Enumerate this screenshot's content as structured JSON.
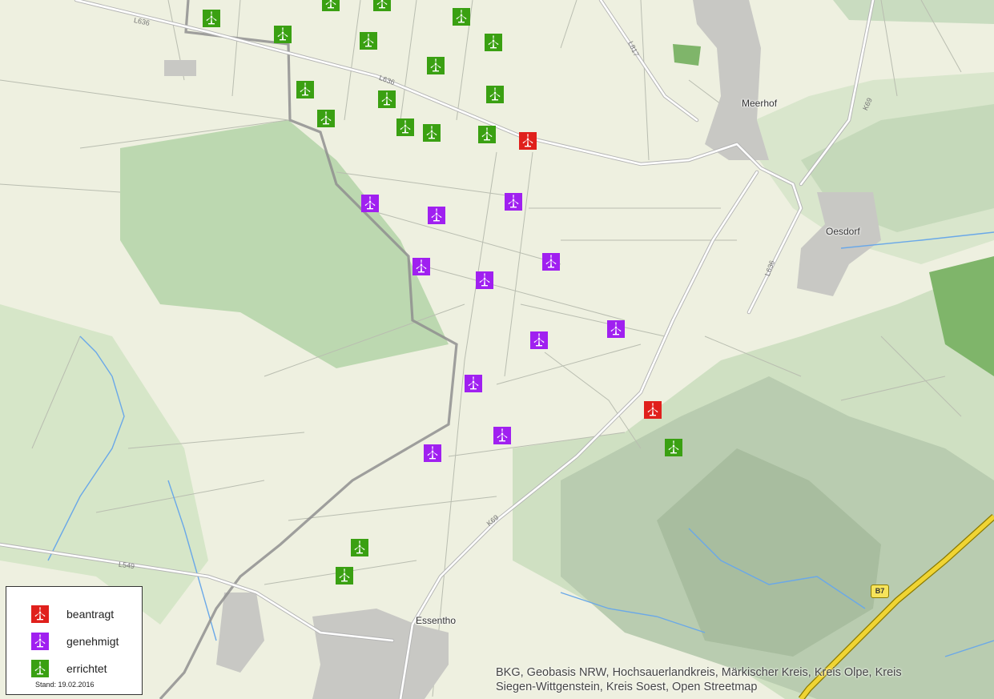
{
  "colors": {
    "beantragt": "#e0201c",
    "genehmigt": "#a020f0",
    "errichtet": "#3aa012"
  },
  "icon": "wind-turbine-icon",
  "places": {
    "meerhof": "Meerhof",
    "oesdorf": "Oesdorf",
    "essentho": "Essentho"
  },
  "roads": {
    "l636_a": "L636",
    "l636_b": "L636",
    "l817": "L817",
    "k69_a": "K69",
    "k69_b": "K69",
    "l636_c": "L636",
    "l549": "L549",
    "b7": "B7"
  },
  "legend": {
    "items": [
      {
        "status": "beantragt",
        "label": "beantragt"
      },
      {
        "status": "genehmigt",
        "label": "genehmigt"
      },
      {
        "status": "errichtet",
        "label": "errichtet"
      }
    ],
    "date": "Stand: 19.02.2016"
  },
  "attribution": {
    "line1": "BKG, Geobasis NRW, Hochsauerlandkreis, Märkischer Kreis, Kreis Olpe, Kreis",
    "line2": "Siegen-Wittgenstein, Kreis Soest, Open Streetmap"
  },
  "turbines": [
    {
      "status": "errichtet"
    },
    {
      "status": "errichtet"
    },
    {
      "status": "errichtet"
    },
    {
      "status": "errichtet"
    },
    {
      "status": "errichtet"
    },
    {
      "status": "errichtet"
    },
    {
      "status": "errichtet"
    },
    {
      "status": "errichtet"
    },
    {
      "status": "errichtet"
    },
    {
      "status": "errichtet"
    },
    {
      "status": "errichtet"
    },
    {
      "status": "errichtet"
    },
    {
      "status": "errichtet"
    },
    {
      "status": "errichtet"
    },
    {
      "status": "errichtet"
    },
    {
      "status": "beantragt"
    },
    {
      "status": "genehmigt"
    },
    {
      "status": "genehmigt"
    },
    {
      "status": "genehmigt"
    },
    {
      "status": "genehmigt"
    },
    {
      "status": "genehmigt"
    },
    {
      "status": "genehmigt"
    },
    {
      "status": "genehmigt"
    },
    {
      "status": "genehmigt"
    },
    {
      "status": "genehmigt"
    },
    {
      "status": "genehmigt"
    },
    {
      "status": "genehmigt"
    },
    {
      "status": "beantragt"
    },
    {
      "status": "errichtet"
    },
    {
      "status": "errichtet"
    },
    {
      "status": "errichtet"
    }
  ]
}
